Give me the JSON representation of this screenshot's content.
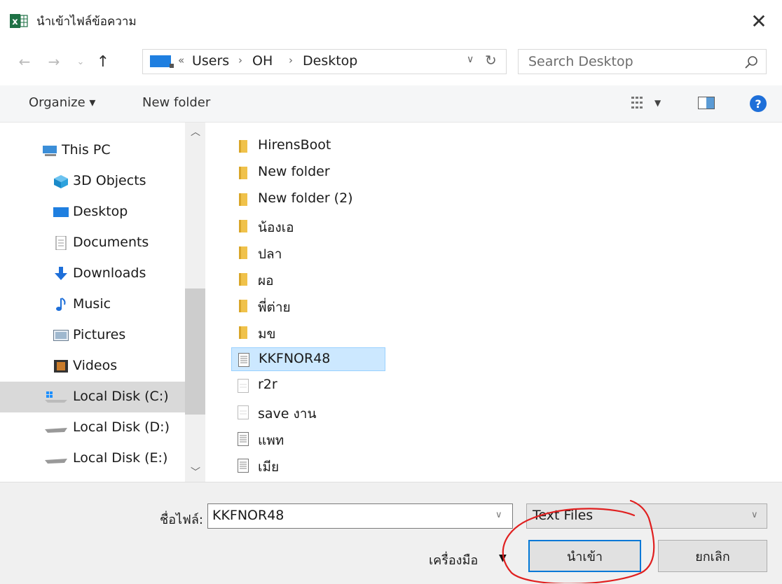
{
  "window": {
    "title": "นำเข้าไฟล์ข้อความ",
    "app_icon": "excel-icon"
  },
  "nav": {
    "breadcrumb": [
      "Users",
      "OH",
      "Desktop"
    ],
    "overflow": "«",
    "search_placeholder": "Search Desktop"
  },
  "toolbar": {
    "organize": "Organize ▾",
    "new_folder": "New folder"
  },
  "sidebar": {
    "items": [
      {
        "label": "This PC",
        "icon": "pc-icon"
      },
      {
        "label": "3D Objects",
        "icon": "cube-icon"
      },
      {
        "label": "Desktop",
        "icon": "desktop-icon"
      },
      {
        "label": "Documents",
        "icon": "document-icon"
      },
      {
        "label": "Downloads",
        "icon": "download-icon"
      },
      {
        "label": "Music",
        "icon": "music-icon"
      },
      {
        "label": "Pictures",
        "icon": "pictures-icon"
      },
      {
        "label": "Videos",
        "icon": "video-icon"
      },
      {
        "label": "Local Disk (C:)",
        "icon": "windows-drive-icon",
        "selected": true
      },
      {
        "label": "Local Disk (D:)",
        "icon": "drive-icon"
      },
      {
        "label": "Local Disk (E:)",
        "icon": "drive-icon"
      }
    ]
  },
  "files": [
    {
      "name": "HirensBoot",
      "type": "folder"
    },
    {
      "name": "New folder",
      "type": "folder"
    },
    {
      "name": "New folder (2)",
      "type": "folder"
    },
    {
      "name": "น้องเอ",
      "type": "folder"
    },
    {
      "name": "ปลา",
      "type": "folder"
    },
    {
      "name": "ผอ",
      "type": "folder"
    },
    {
      "name": "พี่ต่าย",
      "type": "folder"
    },
    {
      "name": "มข",
      "type": "folder"
    },
    {
      "name": "KKFNOR48",
      "type": "text",
      "selected": true
    },
    {
      "name": "r2r",
      "type": "blank"
    },
    {
      "name": "save งาน",
      "type": "blank"
    },
    {
      "name": "แพท",
      "type": "text"
    },
    {
      "name": "เมีย",
      "type": "text"
    }
  ],
  "footer": {
    "filename_label": "ชื่อไฟล์:",
    "filename_value": "KKFNOR48",
    "filetype_value": "Text Files",
    "tools_label": "เครื่องมือ",
    "ok_label": "นำเข้า",
    "cancel_label": "ยกเลิก"
  },
  "colors": {
    "accent": "#0078d7",
    "folder": "#f0c24b",
    "selection": "#cce8ff",
    "annotation": "#e02020"
  }
}
